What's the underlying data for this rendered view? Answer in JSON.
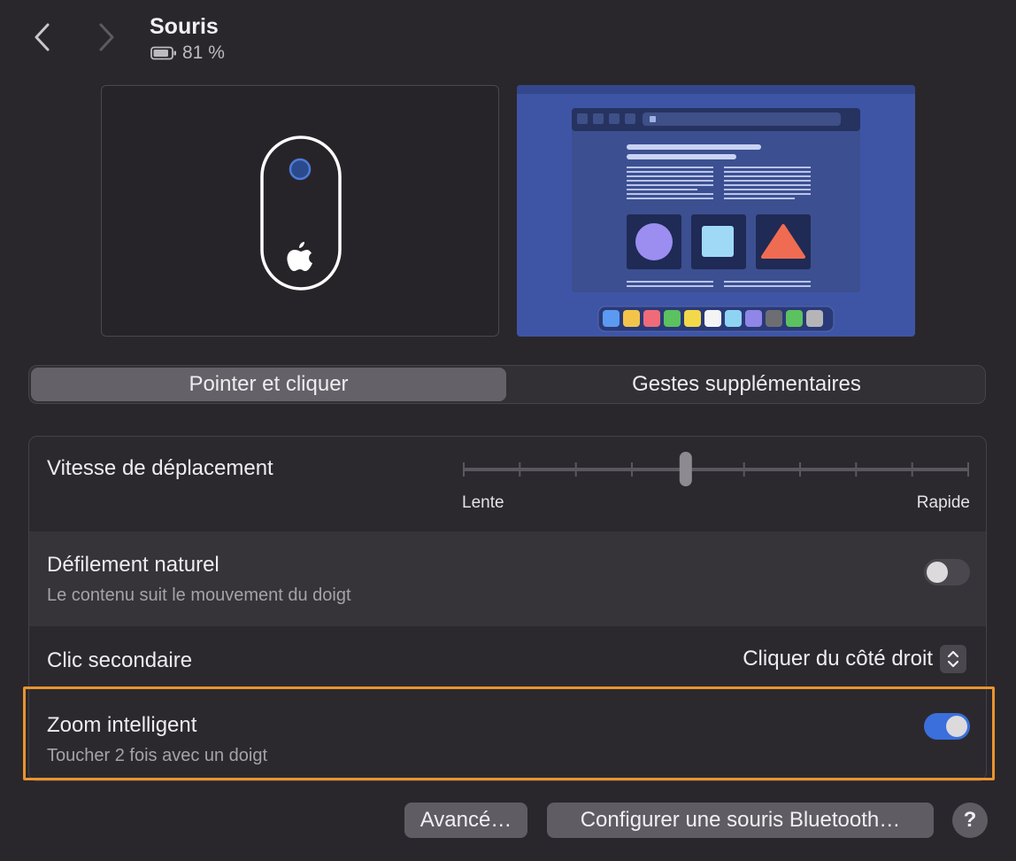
{
  "header": {
    "title": "Souris",
    "battery_percent": "81 %"
  },
  "tabs": [
    {
      "label": "Pointer et cliquer",
      "selected": true
    },
    {
      "label": "Gestes supplémentaires",
      "selected": false
    }
  ],
  "settings": {
    "tracking_speed": {
      "label": "Vitesse de déplacement",
      "min_label": "Lente",
      "max_label": "Rapide",
      "tick_count": 10,
      "value_fraction": 0.44
    },
    "natural_scrolling": {
      "label": "Défilement naturel",
      "description": "Le contenu suit le mouvement du doigt",
      "enabled": false
    },
    "secondary_click": {
      "label": "Clic secondaire",
      "value": "Cliquer du côté droit"
    },
    "smart_zoom": {
      "label": "Zoom intelligent",
      "description": "Toucher 2 fois avec un doigt",
      "enabled": true
    }
  },
  "buttons": {
    "advanced": "Avancé…",
    "setup_bluetooth": "Configurer une souris Bluetooth…",
    "help": "?"
  },
  "colors": {
    "accent": "#3a6fdc",
    "highlight": "#ea942e",
    "preview_background": "#3e55a6"
  }
}
